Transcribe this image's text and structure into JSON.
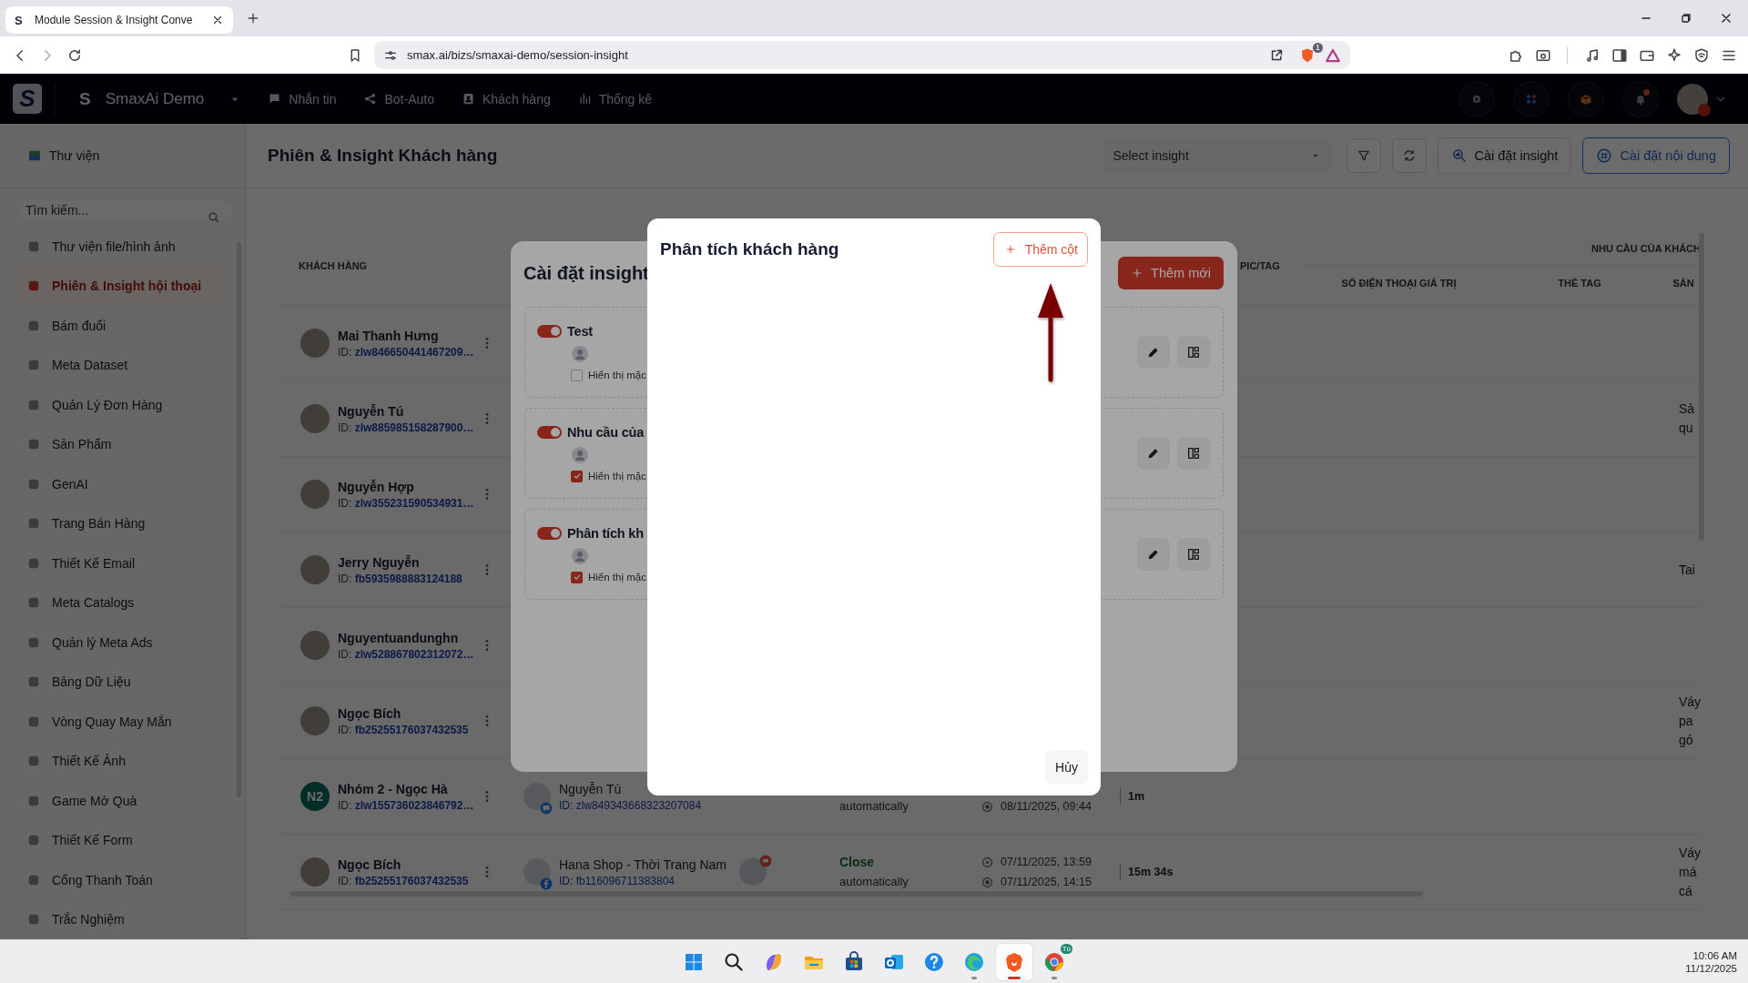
{
  "browser": {
    "tab_title": "Module Session & Insight Conve",
    "url": "smax.ai/bizs/smaxai-demo/session-insight",
    "shield_count": "1",
    "favicon": "S"
  },
  "header": {
    "logo": "S",
    "workspace_initial": "S",
    "workspace": "SmaxAi Demo",
    "notification_dot": true,
    "nav": [
      {
        "label": "Nhắn tin",
        "kind": "chat"
      },
      {
        "label": "Bot-Auto",
        "kind": "nodes"
      },
      {
        "label": "Khách hàng",
        "kind": "contact"
      },
      {
        "label": "Thống kê",
        "kind": "bars"
      }
    ]
  },
  "sidebar": {
    "title": "Thư viện",
    "search_placeholder": "Tìm kiếm...",
    "items": [
      {
        "label": "Thư viện file/hình ảnh",
        "selected": false
      },
      {
        "label": "Phiên & Insight hội thoại",
        "selected": true
      },
      {
        "label": "Bám đuổi",
        "selected": false
      },
      {
        "label": "Meta Dataset",
        "selected": false
      },
      {
        "label": "Quản Lý Đơn Hàng",
        "selected": false
      },
      {
        "label": "Sản Phẩm",
        "selected": false
      },
      {
        "label": "GenAI",
        "selected": false
      },
      {
        "label": "Trang Bán Hàng",
        "selected": false
      },
      {
        "label": "Thiết Kế Email",
        "selected": false
      },
      {
        "label": "Meta Catalogs",
        "selected": false
      },
      {
        "label": "Quản lý Meta Ads",
        "selected": false
      },
      {
        "label": "Bảng Dữ Liệu",
        "selected": false
      },
      {
        "label": "Vòng Quay May Mắn",
        "selected": false
      },
      {
        "label": "Thiết Kế Ảnh",
        "selected": false
      },
      {
        "label": "Game Mở Quà",
        "selected": false
      },
      {
        "label": "Thiết Kế Form",
        "selected": false
      },
      {
        "label": "Cổng Thanh Toán",
        "selected": false
      },
      {
        "label": "Trắc Nghiệm",
        "selected": false
      }
    ]
  },
  "page": {
    "title": "Phiên & Insight Khách hàng",
    "insight_select_placeholder": "Select insight",
    "insight_button": "Cài đặt insight",
    "content_button": "Cài đặt nội dung"
  },
  "table": {
    "header_customer": "KHÁCH HÀNG",
    "header_column_6": "PIC/TAG",
    "group_header": "NHU CẦU CỦA KHÁCH",
    "sub_headers": [
      "SỐ ĐIỆN THOẠI GIÁ TRỊ",
      "THẺ TAG",
      "SẢN"
    ],
    "rows": [
      {
        "customer": "Mai Thanh Hưng",
        "id_label": "ID:",
        "id": "zlw846650441467209…"
      },
      {
        "customer": "Nguyễn Tú",
        "id_label": "ID:",
        "id": "zlw885985158287900…",
        "last_column": [
          "Sả",
          "qu"
        ]
      },
      {
        "customer": "Nguyễn Hợp",
        "id_label": "ID:",
        "id": "zlw355231590534931…"
      },
      {
        "customer": "Jerry Nguyễn",
        "id_label": "ID:",
        "id": "fb5935988883124188",
        "last_column": [
          "Tai"
        ]
      },
      {
        "customer": "Nguyentuandunghn",
        "id_label": "ID:",
        "id": "zlw528867802312072…"
      },
      {
        "customer": "Ngọc Bích",
        "id_label": "ID:",
        "id": "fb25255176037432535",
        "last_column": [
          "Váy",
          "pa",
          "gó"
        ]
      },
      {
        "customer": "Nhóm 2 - Ngọc Hà",
        "initials": "N2",
        "id_label": "ID:",
        "id": "zlw155736023846792…",
        "session": {
          "page": "Nguyễn Tú",
          "page_id_label": "ID:",
          "page_id": "zlw849343668323207084",
          "kind": "zalo",
          "agent_avatar": false,
          "status_note": "automatically",
          "end_time": "08/11/2025, 09:44",
          "duration": "1m"
        }
      },
      {
        "customer": "Ngọc Bích",
        "id_label": "ID:",
        "id": "fb25255176037432535",
        "session": {
          "page": "Hana Shop - Thời Trang Nam",
          "page_id_label": "ID:",
          "page_id": "fb116096711383804",
          "kind": "facebook",
          "agent_avatar": true,
          "status": "Close",
          "status_note": "automatically",
          "start_time": "07/11/2025, 13:59",
          "end_time": "07/11/2025, 14:15",
          "duration": "15m 34s"
        },
        "last_column": [
          "Váy",
          "má",
          "cá"
        ]
      }
    ]
  },
  "insight_modal": {
    "title": "Cài đặt insight",
    "add_button": "Thêm mới",
    "cards": [
      {
        "name": "Test",
        "enabled": true,
        "default_label": "Hiển thị mặc",
        "default_checked": false
      },
      {
        "name": "Nhu cầu của",
        "enabled": true,
        "default_label": "Hiển thị mặc",
        "default_checked": true
      },
      {
        "name": "Phân tích kh",
        "enabled": true,
        "default_label": "Hiển thị mặc",
        "default_checked": true
      }
    ]
  },
  "column_modal": {
    "title": "Phân tích khách hàng",
    "add_button": "Thêm cột",
    "cancel_button": "Hủy"
  },
  "taskbar": {
    "apps": [
      {
        "kind": "start",
        "running": false,
        "selected": false
      },
      {
        "kind": "search",
        "running": false,
        "selected": false
      },
      {
        "kind": "copilot",
        "running": false,
        "selected": false
      },
      {
        "kind": "explorer",
        "running": false,
        "selected": false
      },
      {
        "kind": "store",
        "running": false,
        "selected": false
      },
      {
        "kind": "outlook",
        "running": false,
        "selected": false
      },
      {
        "kind": "help",
        "running": false,
        "selected": false
      },
      {
        "kind": "edge",
        "running": true,
        "selected": false
      },
      {
        "kind": "brave",
        "running": true,
        "selected": true
      },
      {
        "kind": "chrome",
        "running": true,
        "selected": false,
        "badge": "Tú"
      }
    ],
    "time": "10:06 AM",
    "date": "11/12/2025"
  }
}
